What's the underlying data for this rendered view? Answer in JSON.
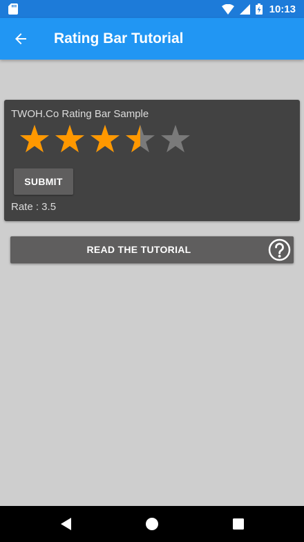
{
  "status_bar": {
    "time": "10:13"
  },
  "app_bar": {
    "title": "Rating Bar Tutorial"
  },
  "card": {
    "title": "TWOH.Co Rating Bar Sample",
    "rating": 3.5,
    "max_rating": 5,
    "submit_label": "SUBMIT",
    "rate_text": "Rate : 3.5"
  },
  "tutorial_button": {
    "label": "READ THE TUTORIAL"
  },
  "icons": {
    "status": [
      "sd-card-icon",
      "wifi-icon",
      "signal-icon",
      "battery-charging-icon"
    ],
    "app_bar": "back-arrow-icon",
    "tutorial": "help-circle-icon",
    "nav": [
      "back-icon",
      "home-icon",
      "recents-icon"
    ]
  },
  "colors": {
    "status_bar": "#1d7bd9",
    "app_bar": "#2196f3",
    "background": "#cecece",
    "card": "#424242",
    "button": "#5f5e5e",
    "star_filled": "#ff9800",
    "star_empty": "#7a7a7a"
  }
}
